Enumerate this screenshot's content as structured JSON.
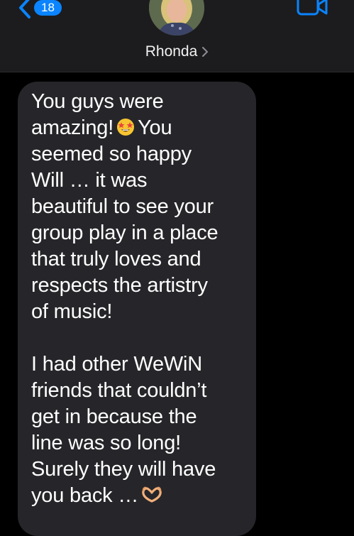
{
  "header": {
    "back_badge": "18",
    "contact_name": "Rhonda"
  },
  "message": {
    "paragraph1": [
      "You guys were",
      "amazing!",
      "You",
      "seemed so happy",
      "Will … it was",
      "beautiful to see your",
      "group play in a place",
      "that truly loves and",
      "respects the artistry",
      "of music!"
    ],
    "paragraph2": [
      "I had other WeWiN",
      "friends that couldn’t",
      "get in because the",
      "line was so long!",
      "Surely they will have",
      "you back …"
    ],
    "emojis": {
      "line2": "star-struck-emoji",
      "last_line": "heart-hands-emoji"
    }
  },
  "colors": {
    "header_bg": "#1c1c1e",
    "bubble_bg": "#26262a",
    "accent": "#0a84ff",
    "page_bg": "#000000"
  }
}
